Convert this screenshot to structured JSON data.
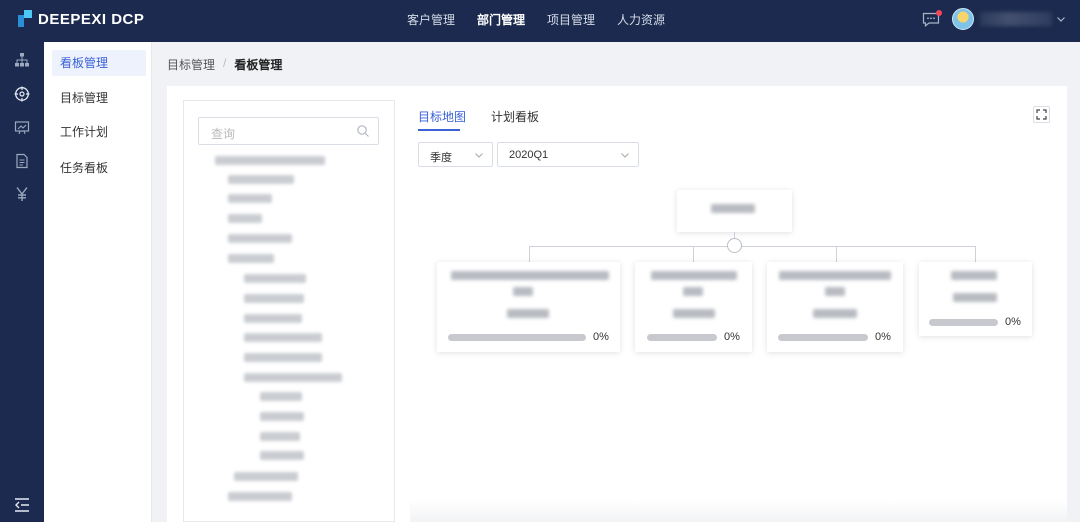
{
  "app": {
    "logo_text": "DEEPEXI DCP"
  },
  "topnav": [
    {
      "label": "客户管理",
      "active": false
    },
    {
      "label": "部门管理",
      "active": true
    },
    {
      "label": "项目管理",
      "active": false
    },
    {
      "label": "人力资源",
      "active": false
    }
  ],
  "iconbar": [
    "org-tree-icon",
    "target-icon",
    "board-icon",
    "document-icon",
    "yen-icon"
  ],
  "sidebar": [
    {
      "label": "看板管理",
      "active": true
    },
    {
      "label": "目标管理",
      "active": false
    },
    {
      "label": "工作计划",
      "active": false
    },
    {
      "label": "任务看板",
      "active": false
    }
  ],
  "breadcrumb": {
    "parent": "目标管理",
    "separator": "/",
    "current": "看板管理"
  },
  "search": {
    "placeholder": "查询"
  },
  "tabs": [
    {
      "label": "目标地图",
      "active": true
    },
    {
      "label": "计划看板",
      "active": false
    }
  ],
  "filters": {
    "period_type": "季度",
    "period": "2020Q1"
  },
  "cards": [
    {
      "progress_percent": 0,
      "progress_label": "0%"
    },
    {
      "progress_percent": 0,
      "progress_label": "0%"
    },
    {
      "progress_percent": 0,
      "progress_label": "0%"
    },
    {
      "progress_percent": 0,
      "progress_label": "0%"
    }
  ],
  "colors": {
    "nav_bg": "#1b2a4e",
    "accent": "#3a62d7",
    "notification": "#f5455c"
  }
}
